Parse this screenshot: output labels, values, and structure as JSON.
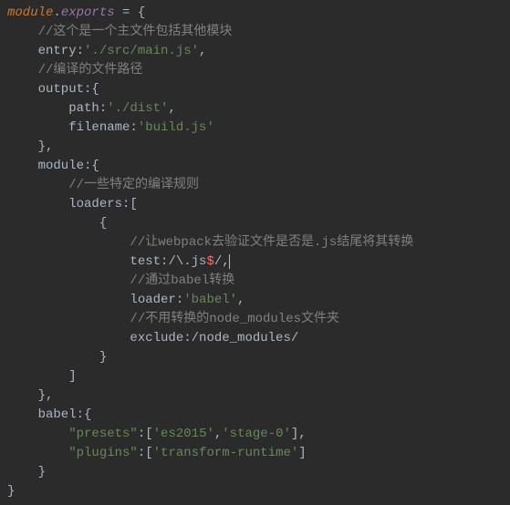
{
  "code": {
    "l01a": "module",
    "l01b": ".",
    "l01c": "exports",
    "l01d": " = {",
    "l02": "    //这个是一个主文件包括其他模块",
    "l03a": "    entry:",
    "l03b": "'./src/main.js'",
    "l03c": ",",
    "l04": "    //编译的文件路径",
    "l05": "    output:{",
    "l06a": "        path:",
    "l06b": "'./dist'",
    "l06c": ",",
    "l07a": "        filename:",
    "l07b": "'build.js'",
    "l08": "    },",
    "l09": "    module:{",
    "l10": "        //一些特定的编译规则",
    "l11": "        loaders:[",
    "l12": "            {",
    "l13": "                //让webpack去验证文件是否是.js结尾将其转换",
    "l14a": "                test:",
    "l14b": "/",
    "l14c": "\\.",
    "l14d": "js",
    "l14e": "$",
    "l14f": "/",
    "l14g": ",",
    "l15": "                //通过babel转换",
    "l16a": "                loader:",
    "l16b": "'babel'",
    "l16c": ",",
    "l17": "                //不用转换的node_modules文件夹",
    "l18a": "                exclude:",
    "l18b": "/node_modules/",
    "l19": "            }",
    "l20": "        ]",
    "l21": "    },",
    "l22": "    babel:{",
    "l23a": "        ",
    "l23b": "\"presets\"",
    "l23c": ":[",
    "l23d": "'es2015'",
    "l23e": ",",
    "l23f": "'stage-0'",
    "l23g": "],",
    "l24a": "        ",
    "l24b": "\"plugins\"",
    "l24c": ":[",
    "l24d": "'transform-runtime'",
    "l24e": "]",
    "l25": "    }",
    "l26": "}"
  }
}
